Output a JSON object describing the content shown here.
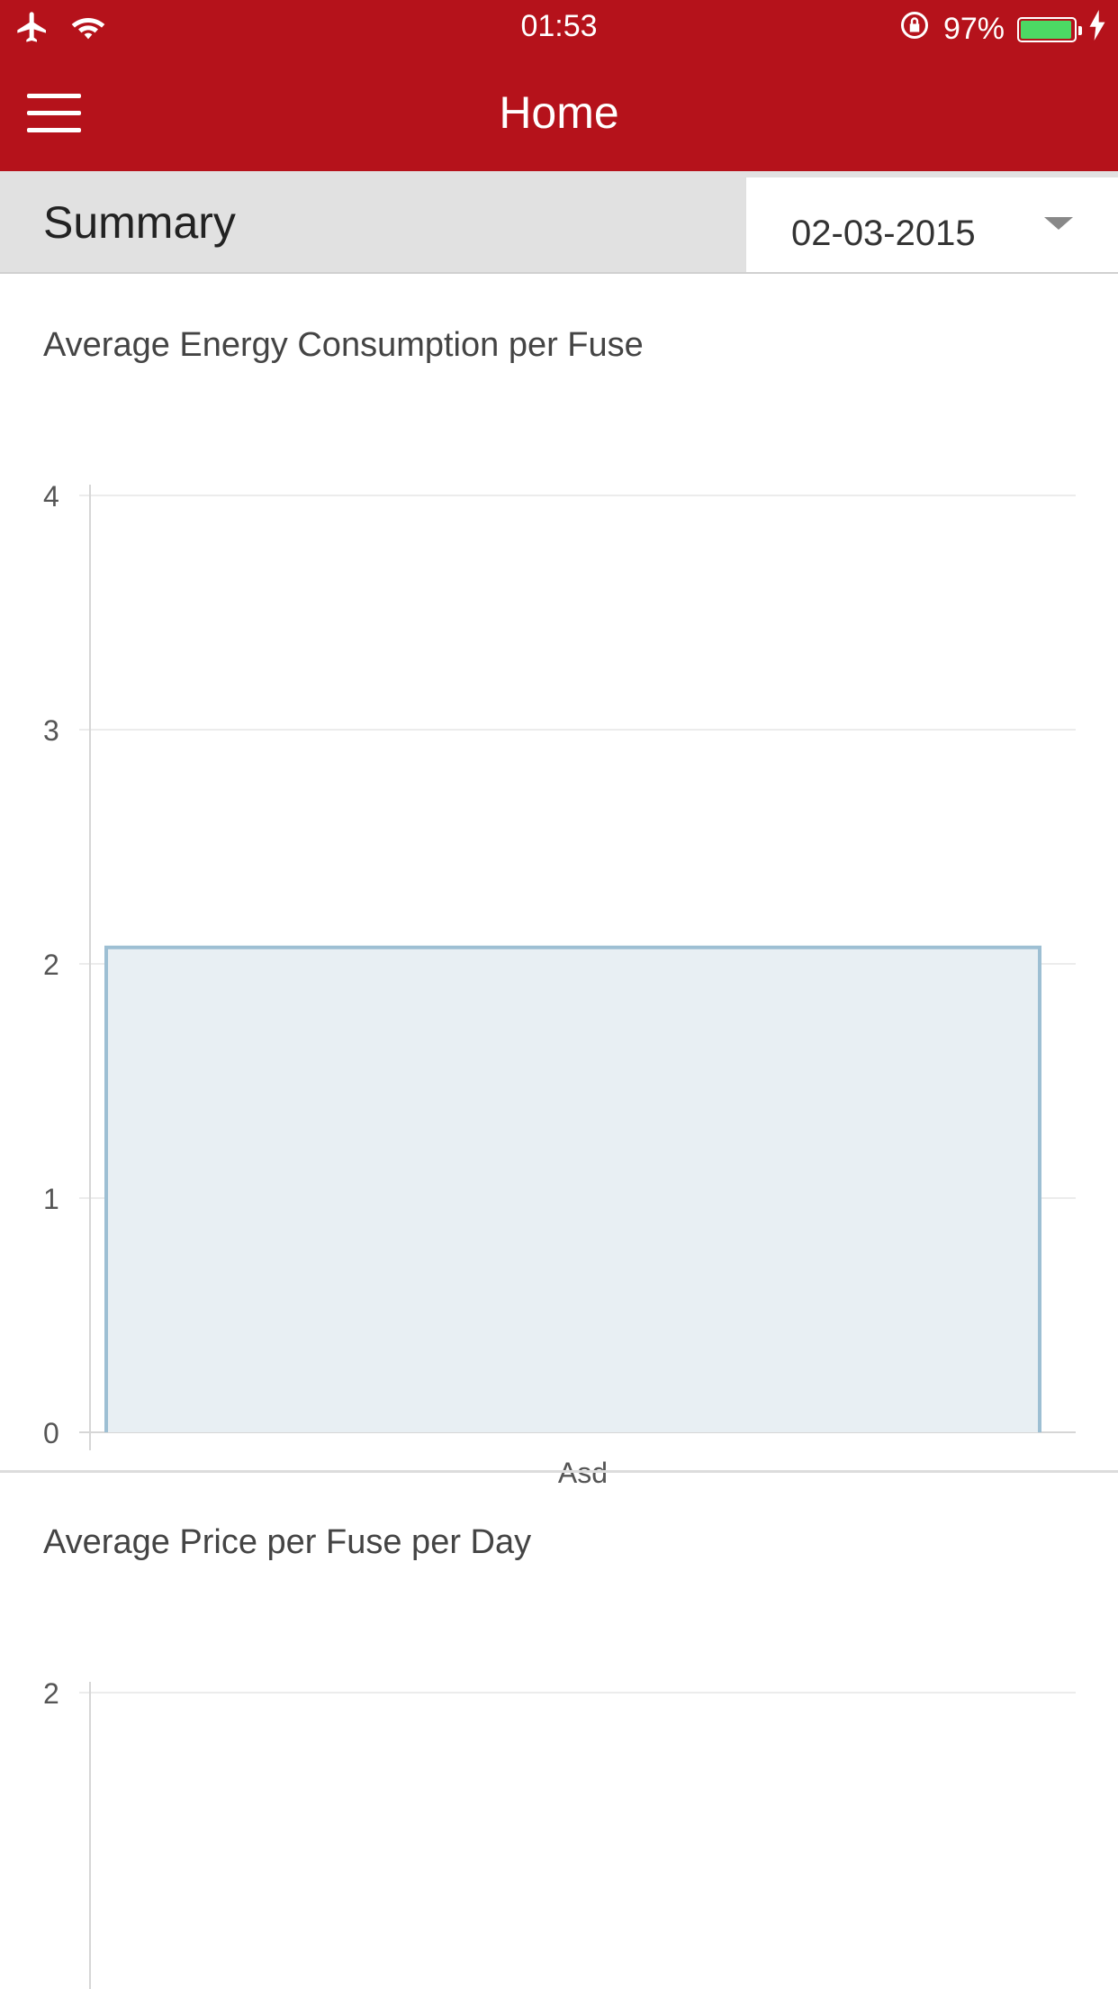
{
  "status_bar": {
    "time": "01:53",
    "battery_percent_label": "97%",
    "battery_level": 0.97,
    "icons": [
      "airplane-mode-icon",
      "wifi-icon",
      "rotation-lock-icon",
      "battery-icon",
      "charging-icon"
    ]
  },
  "app_bar": {
    "title": "Home",
    "menu_icon": "hamburger-menu-icon",
    "background_color": "#b5121b"
  },
  "summary_bar": {
    "label": "Summary",
    "date_value": "02-03-2015"
  },
  "chart_data": [
    {
      "type": "bar",
      "title": "Average Energy Consumption per Fuse",
      "categories": [
        "Asd"
      ],
      "values": [
        2.07
      ],
      "ylim": [
        0,
        4
      ],
      "y_ticks": [
        "0",
        "1",
        "2",
        "3",
        "4"
      ],
      "grid": true,
      "bar_color": "#9dbfd3",
      "bar_fill": "#e8eff3"
    },
    {
      "type": "bar",
      "title": "Average Price per Fuse per Day",
      "categories": [],
      "values": [],
      "y_ticks": [
        "2"
      ],
      "grid": true
    }
  ]
}
